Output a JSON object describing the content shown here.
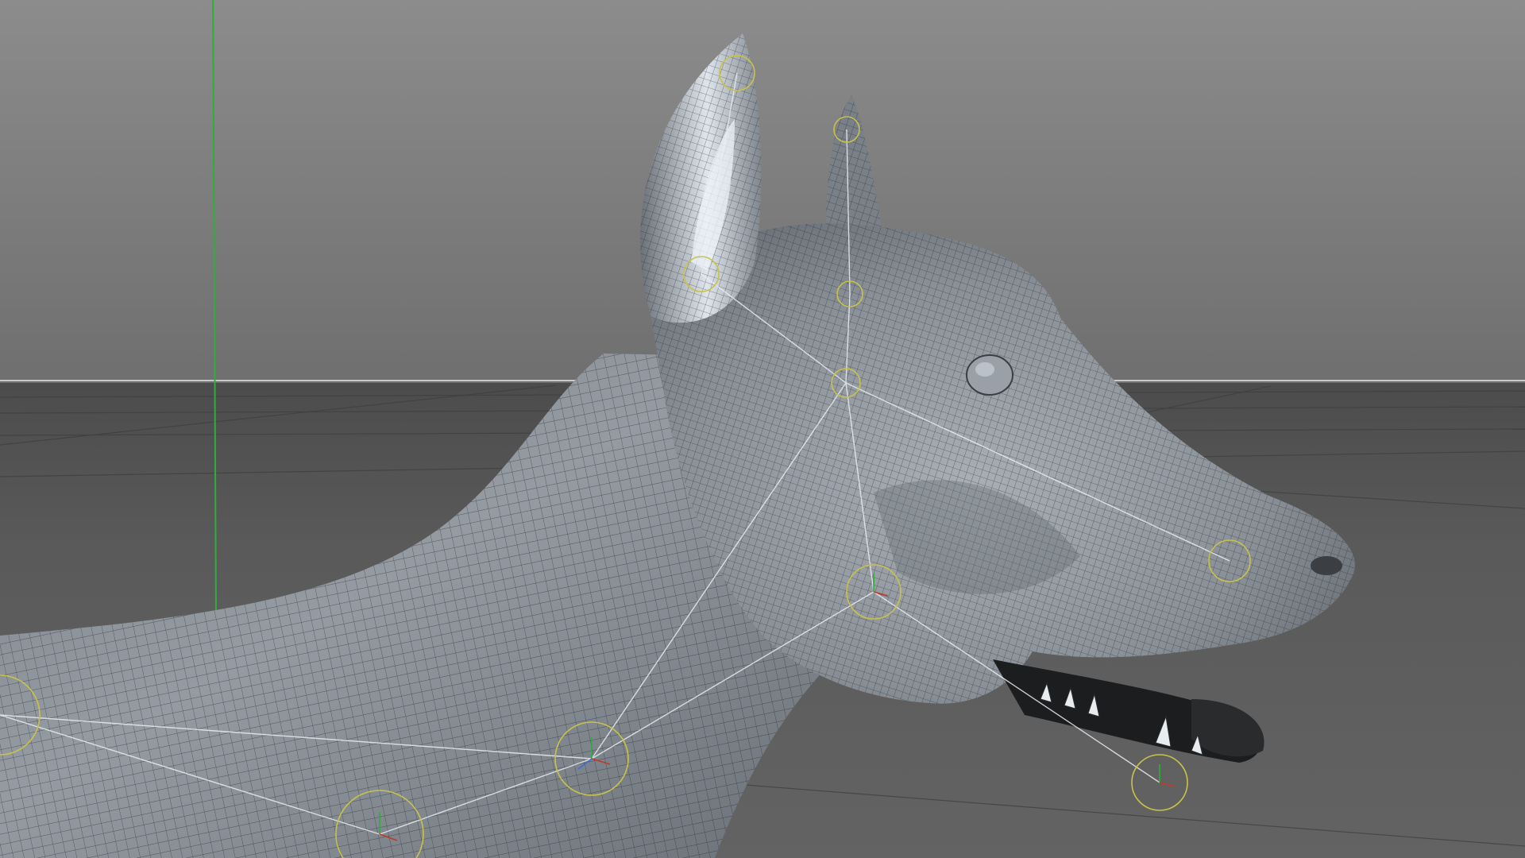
{
  "viewport": {
    "projection": "perspective",
    "model": "dog-head-wireframe-mesh",
    "display_mode": "gouraud-shading-with-wireframe-lines",
    "axis_colors": {
      "y_axis": "#2fae3a",
      "x_axis": "#c0392b",
      "z_axis": "#3a6fd0"
    },
    "colors": {
      "sky_top": "#8c8c8c",
      "sky_bottom": "#6f6f6f",
      "floor": "#595959",
      "horizon_line": "#c9c9c9",
      "mesh_light": "#c3c9d0",
      "mesh_mid": "#8e949b",
      "mesh_dark": "#4a4e53",
      "wire": "#1e2024",
      "bone_line": "#e8edf2",
      "joint_ring": "#c9c24a"
    },
    "joints": [
      {
        "id": "ear-left-tip"
      },
      {
        "id": "ear-left-base"
      },
      {
        "id": "ear-right-tip"
      },
      {
        "id": "ear-right-base"
      },
      {
        "id": "head"
      },
      {
        "id": "jaw"
      },
      {
        "id": "nose"
      },
      {
        "id": "jaw-tip"
      },
      {
        "id": "neck-upper"
      },
      {
        "id": "neck-lower"
      },
      {
        "id": "spine"
      }
    ]
  }
}
